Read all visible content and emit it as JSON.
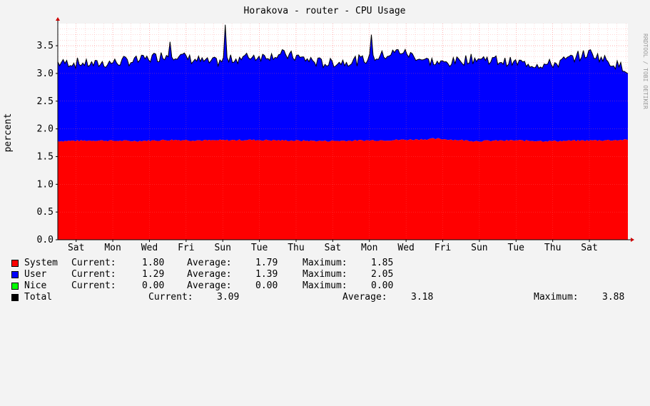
{
  "chart_data": {
    "type": "area",
    "title": "Horakova - router - CPU Usage",
    "ylabel": "percent",
    "xlabel": "",
    "watermark": "RRDTOOL / TOBI OETIKER",
    "ylim": [
      0,
      3.9
    ],
    "yticks": [
      "0.0",
      "0.5",
      "1.0",
      "1.5",
      "2.0",
      "2.5",
      "3.0",
      "3.5"
    ],
    "ytick_values": [
      0,
      0.5,
      1.0,
      1.5,
      2.0,
      2.5,
      3.0,
      3.5
    ],
    "x": [
      "Sat",
      "Mon",
      "Wed",
      "Fri",
      "Sun",
      "Tue",
      "Thu",
      "Sat",
      "Mon",
      "Wed",
      "Fri",
      "Sun",
      "Tue",
      "Thu",
      "Sat"
    ],
    "stacked": true,
    "grid": true,
    "series": [
      {
        "name": "System",
        "color": "#ff0000",
        "values": [
          1.78,
          1.79,
          1.78,
          1.8,
          1.79,
          1.8,
          1.79,
          1.78,
          1.79,
          1.8,
          1.82,
          1.78,
          1.79,
          1.78,
          1.79,
          1.8
        ]
      },
      {
        "name": "User",
        "color": "#0000ff",
        "values": [
          1.42,
          1.38,
          1.45,
          1.55,
          1.4,
          1.5,
          1.55,
          1.4,
          1.45,
          1.6,
          1.35,
          1.5,
          1.4,
          1.38,
          1.58,
          1.27
        ]
      },
      {
        "name": "Nice",
        "color": "#00ff00",
        "values": [
          0,
          0,
          0,
          0,
          0,
          0,
          0,
          0,
          0,
          0,
          0,
          0,
          0,
          0,
          0,
          0
        ]
      }
    ],
    "total_line": {
      "name": "Total",
      "color": "#000000"
    },
    "peaks": [
      3.57,
      3.88,
      3.7
    ],
    "legend": [
      {
        "name": "System",
        "color": "#ff0000",
        "current_label": "Current:",
        "current": "1.80",
        "average_label": "Average:",
        "average": "1.79",
        "maximum_label": "Maximum:",
        "maximum": "1.85"
      },
      {
        "name": "User",
        "color": "#0000ff",
        "current_label": "Current:",
        "current": "1.29",
        "average_label": "Average:",
        "average": "1.39",
        "maximum_label": "Maximum:",
        "maximum": "2.05"
      },
      {
        "name": "Nice",
        "color": "#00ff00",
        "current_label": "Current:",
        "current": "0.00",
        "average_label": "Average:",
        "average": "0.00",
        "maximum_label": "Maximum:",
        "maximum": "0.00"
      }
    ],
    "total": {
      "name": "Total",
      "color": "#000000",
      "current_label": "Current:",
      "current": "3.09",
      "average_label": "Average:",
      "average": "3.18",
      "maximum_label": "Maximum:",
      "maximum": "3.88"
    }
  }
}
